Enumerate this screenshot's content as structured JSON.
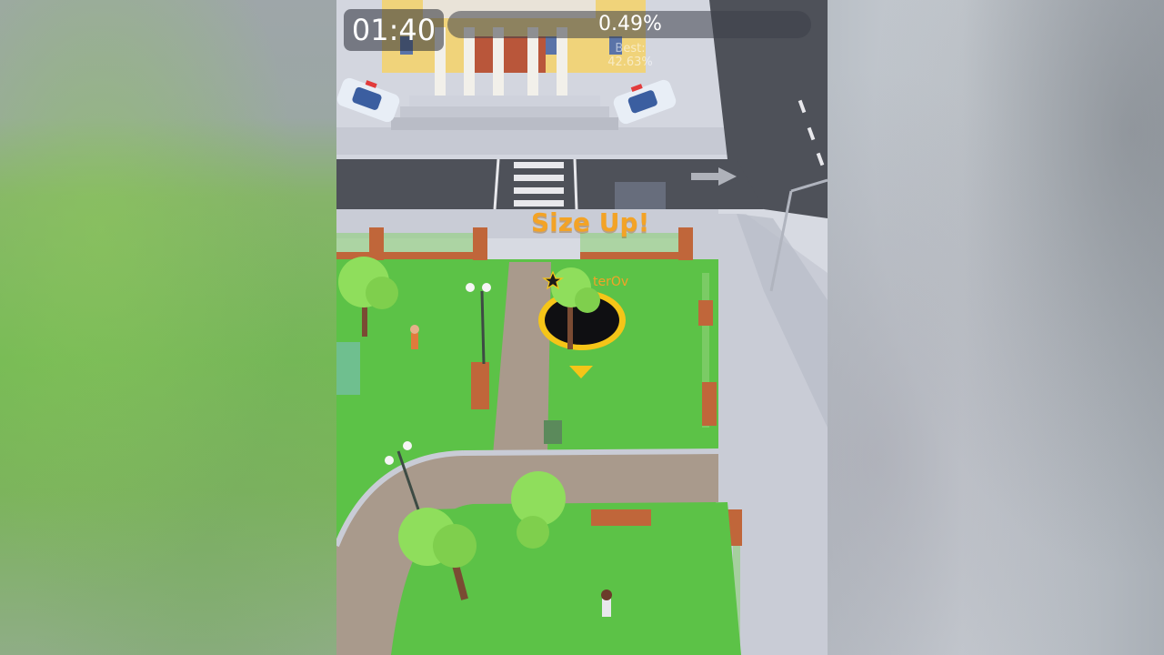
{
  "hud": {
    "timer": "01:40",
    "percentage": "0.49%",
    "best": "Best: 42.63%"
  },
  "popup": {
    "size_up": "Size Up!"
  },
  "player": {
    "name": "terOv"
  },
  "colors": {
    "grass": "#5cc247",
    "road": "#4e5159",
    "sidewalk": "#c9ccd6",
    "path": "#a99a8c",
    "hole_ring": "#f5c518",
    "accent_text": "#f3a326"
  },
  "icons": {
    "crown": "star-icon",
    "pointer": "triangle-down-icon"
  }
}
